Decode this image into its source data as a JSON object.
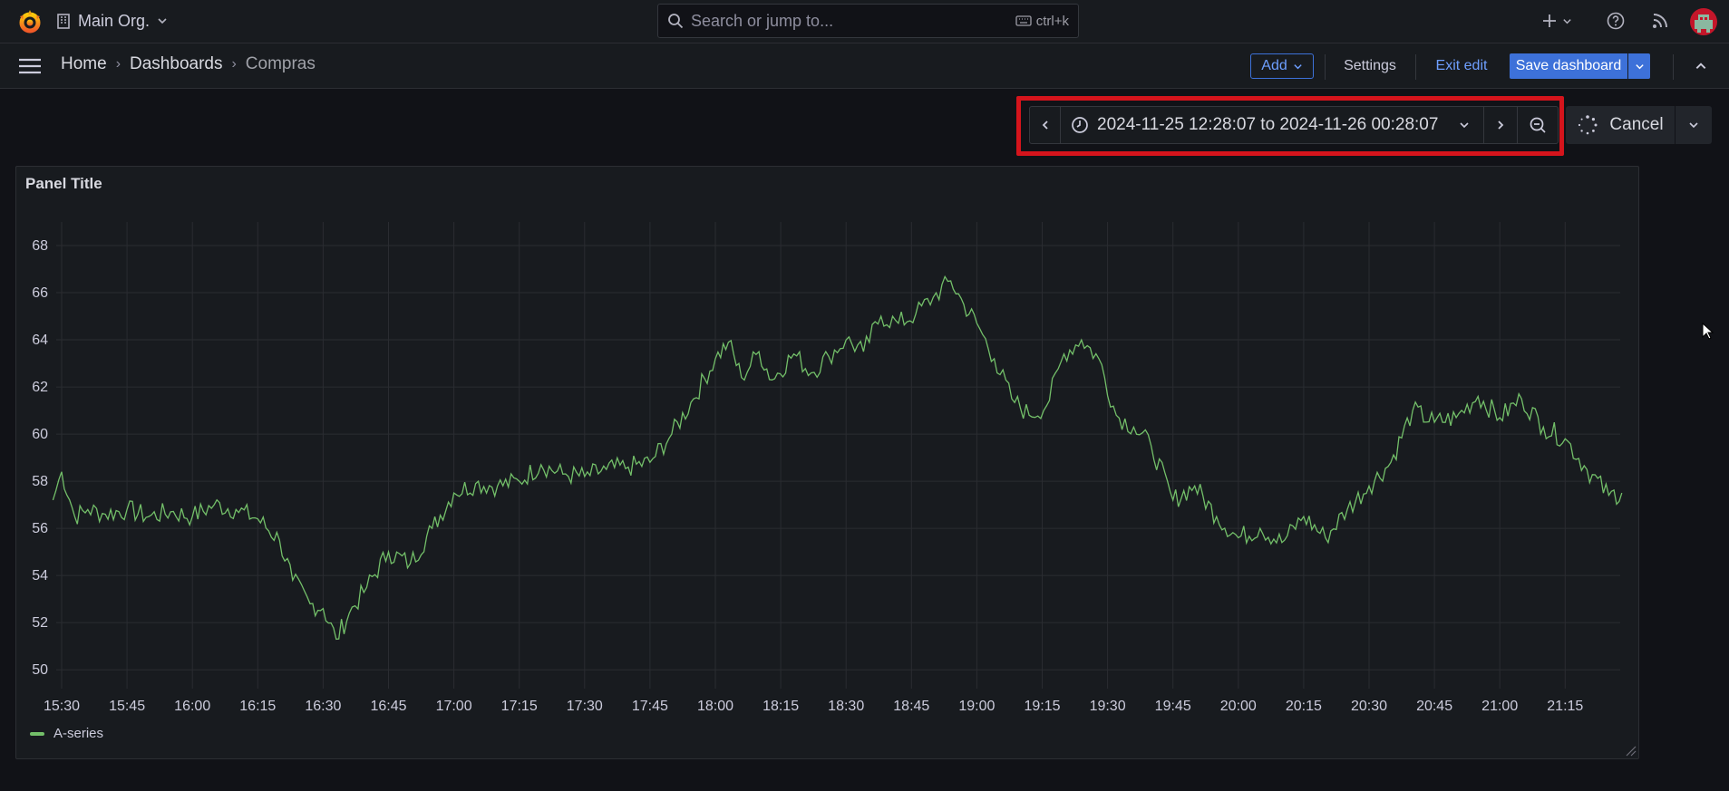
{
  "topbar": {
    "org_name": "Main Org.",
    "search_placeholder": "Search or jump to...",
    "search_shortcut": "ctrl+k"
  },
  "breadcrumb": [
    "Home",
    "Dashboards",
    "Compras"
  ],
  "toolbar": {
    "add_label": "Add",
    "settings_label": "Settings",
    "exit_edit_label": "Exit edit",
    "save_label": "Save dashboard"
  },
  "time_picker": {
    "range_label": "2024-11-25 12:28:07 to 2024-11-26 00:28:07",
    "cancel_label": "Cancel"
  },
  "panel": {
    "title": "Panel Title",
    "legend": "A-series"
  },
  "colors": {
    "series": "#73bf69",
    "accent": "#3d71d9",
    "highlight": "#d5141c"
  },
  "chart_data": {
    "type": "line",
    "x_ticks": [
      "15:30",
      "15:45",
      "16:00",
      "16:15",
      "16:30",
      "16:45",
      "17:00",
      "17:15",
      "17:30",
      "17:45",
      "18:00",
      "18:15",
      "18:30",
      "18:45",
      "19:00",
      "19:15",
      "19:30",
      "19:45",
      "20:00",
      "20:15",
      "20:30",
      "20:45",
      "21:00",
      "21:15"
    ],
    "y_ticks": [
      50,
      52,
      54,
      56,
      58,
      60,
      62,
      64,
      66,
      68
    ],
    "ylim": [
      49.2,
      69.0
    ],
    "series": [
      {
        "name": "A-series",
        "x": [
          "15:28",
          "15:30",
          "15:33",
          "15:36",
          "15:40",
          "15:45",
          "15:50",
          "15:55",
          "16:00",
          "16:05",
          "16:10",
          "16:15",
          "16:20",
          "16:23",
          "16:27",
          "16:30",
          "16:33",
          "16:36",
          "16:40",
          "16:45",
          "16:50",
          "16:55",
          "17:00",
          "17:05",
          "17:10",
          "17:15",
          "17:20",
          "17:25",
          "17:30",
          "17:35",
          "17:40",
          "17:45",
          "17:50",
          "17:55",
          "18:00",
          "18:03",
          "18:06",
          "18:10",
          "18:13",
          "18:18",
          "18:22",
          "18:26",
          "18:30",
          "18:34",
          "18:38",
          "18:42",
          "18:46",
          "18:50",
          "18:54",
          "18:57",
          "19:00",
          "19:04",
          "19:08",
          "19:12",
          "19:16",
          "19:20",
          "19:24",
          "19:28",
          "19:32",
          "19:36",
          "19:40",
          "19:45",
          "19:50",
          "19:55",
          "20:00",
          "20:05",
          "20:10",
          "20:15",
          "20:20",
          "20:25",
          "20:30",
          "20:35",
          "20:40",
          "20:45",
          "20:50",
          "20:55",
          "21:00",
          "21:05",
          "21:10",
          "21:15",
          "21:20",
          "21:25",
          "21:28"
        ],
        "y": [
          57.2,
          58.4,
          56.5,
          56.8,
          56.6,
          56.8,
          56.5,
          56.7,
          56.5,
          57.0,
          56.8,
          56.4,
          55.5,
          53.8,
          52.8,
          52.6,
          51.3,
          52.4,
          53.5,
          55.0,
          54.5,
          56.0,
          57.5,
          57.9,
          57.8,
          58.0,
          58.7,
          58.3,
          58.2,
          58.5,
          58.6,
          58.8,
          60.0,
          61.5,
          63.2,
          63.9,
          62.4,
          63.5,
          62.3,
          63.4,
          62.6,
          63.3,
          64.0,
          63.5,
          65.0,
          64.7,
          65.1,
          65.8,
          66.5,
          65.5,
          64.7,
          63.2,
          61.5,
          60.8,
          61.2,
          63.4,
          64.0,
          63.2,
          60.8,
          60.3,
          59.5,
          57.2,
          57.8,
          56.5,
          55.6,
          56.0,
          55.4,
          56.5,
          55.6,
          56.8,
          57.8,
          58.8,
          61.0,
          60.5,
          60.7,
          61.6,
          60.7,
          61.5,
          60.3,
          59.8,
          58.5,
          57.4,
          57.5
        ]
      }
    ]
  }
}
